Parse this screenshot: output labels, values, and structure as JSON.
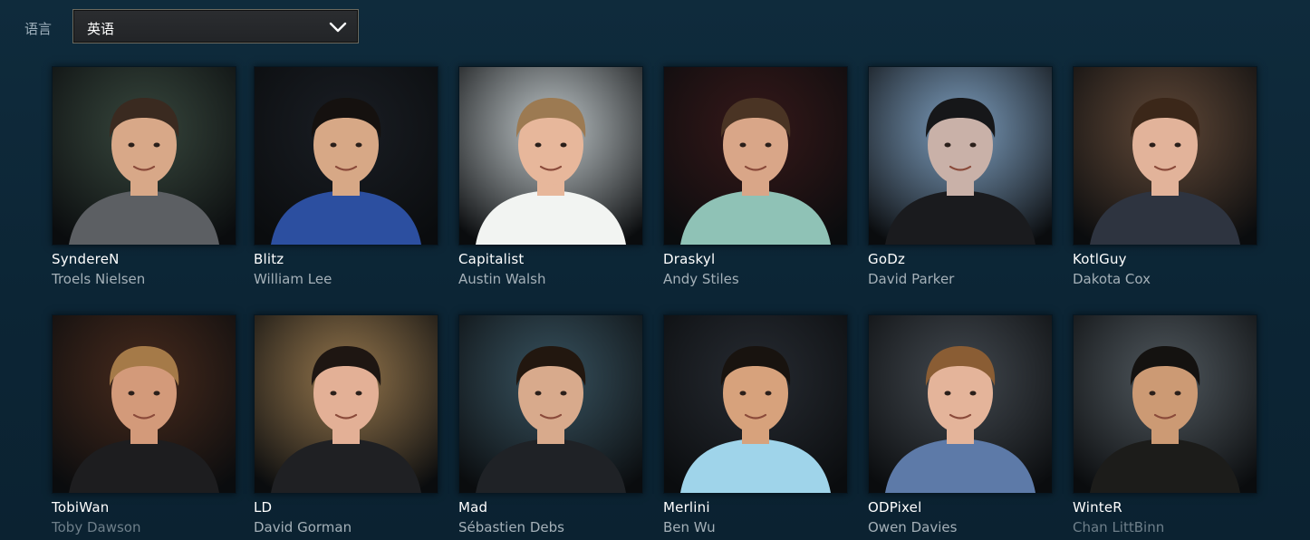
{
  "language": {
    "label": "语言",
    "selected": "英语"
  },
  "casters": [
    {
      "handle": "SyndereN",
      "name": "Troels Nielsen",
      "bg": "#3d4a3c",
      "skin": "#d8a888",
      "hair": "#3a2a20",
      "shirt": "#5c5f63"
    },
    {
      "handle": "Blitz",
      "name": "William Lee",
      "bg": "#1b1b1f",
      "skin": "#d7a886",
      "hair": "#15110f",
      "shirt": "#2c4fa0"
    },
    {
      "handle": "Capitalist",
      "name": "Austin Walsh",
      "bg": "#d8dcdc",
      "skin": "#e7b79b",
      "hair": "#9c7a52",
      "shirt": "#f2f4f2"
    },
    {
      "handle": "Draskyl",
      "name": "Andy Stiles",
      "bg": "#3b1513",
      "skin": "#d9a688",
      "hair": "#4a3424",
      "shirt": "#8fc2b6"
    },
    {
      "handle": "GoDz",
      "name": "David Parker",
      "bg": "#8daed0",
      "skin": "#c9b1a8",
      "hair": "#161719",
      "shirt": "#1a1b1e"
    },
    {
      "handle": "KotlGuy",
      "name": "Dakota Cox",
      "bg": "#6b4b35",
      "skin": "#e2b39a",
      "hair": "#3b2719",
      "shirt": "#2e3440"
    },
    {
      "handle": "TobiWan",
      "name": "Toby Dawson",
      "bg": "#4f2a18",
      "skin": "#d39a7a",
      "hair": "#a57a48",
      "shirt": "#1d1d1f"
    },
    {
      "handle": "LD",
      "name": "David Gorman",
      "bg": "#a7804e",
      "skin": "#e3b096",
      "hair": "#1e1612",
      "shirt": "#1f2023"
    },
    {
      "handle": "Mad",
      "name": "Sébastien Debs",
      "bg": "#3e5864",
      "skin": "#d8aa8c",
      "hair": "#22170f",
      "shirt": "#1f2226"
    },
    {
      "handle": "Merlini",
      "name": "Ben Wu",
      "bg": "#2a2b30",
      "skin": "#d7a27c",
      "hair": "#18130f",
      "shirt": "#9fd4ea"
    },
    {
      "handle": "ODPixel",
      "name": "Owen Davies",
      "bg": "#4a4d52",
      "skin": "#e4b49a",
      "hair": "#8a5d34",
      "shirt": "#5d7aa8"
    },
    {
      "handle": "WinteR",
      "name": "Chan LittBinn",
      "bg": "#5a5f63",
      "skin": "#cc9a74",
      "hair": "#141210",
      "shirt": "#1c1c1a"
    }
  ]
}
